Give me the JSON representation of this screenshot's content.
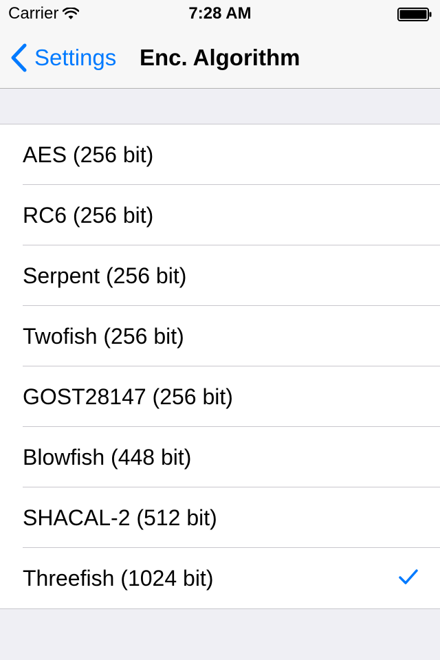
{
  "status_bar": {
    "carrier": "Carrier",
    "time": "7:28 AM"
  },
  "nav": {
    "back_label": "Settings",
    "title": "Enc. Algorithm"
  },
  "accent_color": "#007aff",
  "algorithms": [
    {
      "label": "AES (256 bit)",
      "selected": false
    },
    {
      "label": "RC6 (256 bit)",
      "selected": false
    },
    {
      "label": "Serpent (256 bit)",
      "selected": false
    },
    {
      "label": "Twofish (256 bit)",
      "selected": false
    },
    {
      "label": "GOST28147 (256 bit)",
      "selected": false
    },
    {
      "label": "Blowfish (448 bit)",
      "selected": false
    },
    {
      "label": "SHACAL-2 (512 bit)",
      "selected": false
    },
    {
      "label": "Threefish (1024 bit)",
      "selected": true
    }
  ]
}
